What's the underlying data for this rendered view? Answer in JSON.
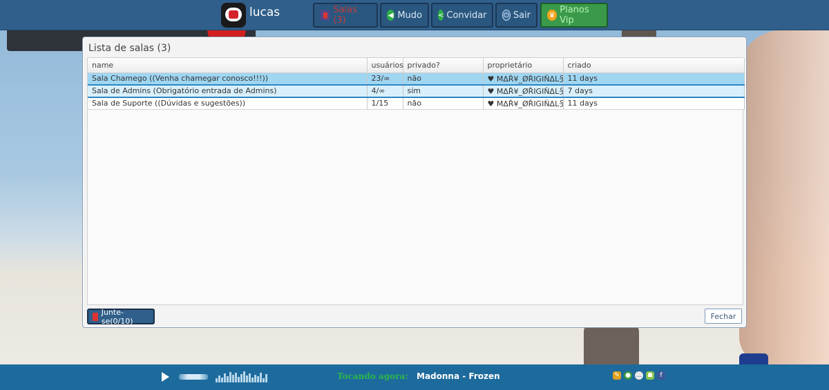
{
  "topbar": {
    "username": "lucas",
    "buttons": {
      "salas": "Salas (3)",
      "mudo": "Mudo",
      "convidar": "Convidar",
      "sair": "Sair",
      "vip": "Planos Vip"
    }
  },
  "dialog": {
    "title": "Lista de salas (3)",
    "columns": {
      "name": "name",
      "users": "usuários",
      "private": "privado?",
      "owner": "proprietário",
      "created": "criado"
    },
    "rows": [
      {
        "name": "Sala Chamego ((Venha chamegar conosco!!!))",
        "users": "23/∞",
        "private": "não",
        "owner": "♥ MΔŘ¥_ØŘIGIŇΔL웃",
        "created": "11 days"
      },
      {
        "name": "Sala de Admins (Obrigatório entrada de Admins)",
        "users": "4/∞",
        "private": "sim",
        "owner": "♥ MΔŘ¥_ØŘIGIŇΔL웃",
        "created": "7 days"
      },
      {
        "name": "Sala de Suporte ((Dúvidas e sugestões))",
        "users": "1/15",
        "private": "não",
        "owner": "♥ MΔŘ¥_ØŘIGIŇΔL웃",
        "created": "11 days"
      }
    ],
    "join_label": "Junte-se(0/10)",
    "close_label": "Fechar"
  },
  "player": {
    "now_playing_label": "Tocando agora:",
    "track": "Madonna - Frozen"
  },
  "icons": {
    "salas": "door-icon",
    "mudo": "speaker-icon",
    "convidar": "share-icon",
    "sair": "exit-icon",
    "vip": "crown-icon"
  },
  "colors": {
    "topbar": "#2f5f8a",
    "vip": "#3a9a4a",
    "selected_row": "#9fd6f2",
    "bottombar": "#1d6a9c",
    "now_playing": "#2eb84a"
  }
}
